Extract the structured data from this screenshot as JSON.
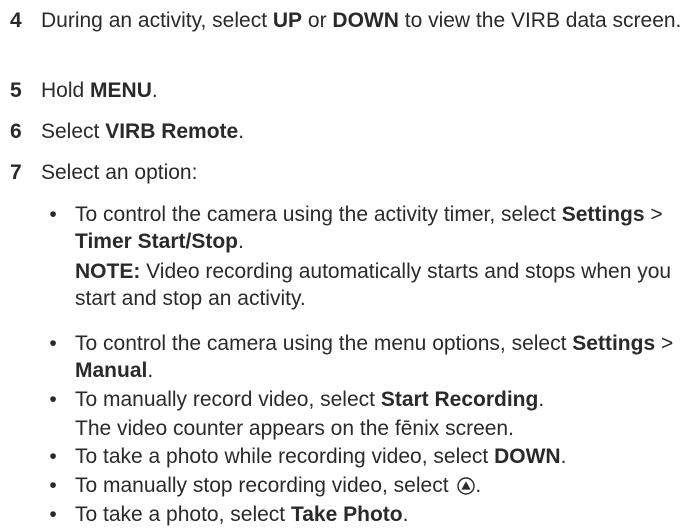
{
  "steps": [
    {
      "num": "4",
      "p1": "During an activity, select ",
      "b1": "UP",
      "p2": " or ",
      "b2": "DOWN",
      "p3": " to view the VIRB data screen."
    },
    {
      "num": "5",
      "p1": "Hold ",
      "b1": "MENU",
      "p2": "."
    },
    {
      "num": "6",
      "p1": "Select ",
      "b1": "VIRB Remote",
      "p2": "."
    },
    {
      "num": "7",
      "p1": "Select an option:"
    }
  ],
  "bullets": [
    {
      "p1": "To control the camera using the activity timer, select ",
      "b1": "Settings",
      "p2": " > ",
      "b2": "Timer Start/Stop",
      "p3": "."
    },
    {
      "p1": "To control the camera using the menu options, select ",
      "b1": "Settings",
      "p2": " > ",
      "b2": "Manual",
      "p3": "."
    },
    {
      "p1": "To manually record video, select ",
      "b1": "Start Recording",
      "p2": "."
    },
    {
      "p1": "To take a photo while recording video, select ",
      "b1": "DOWN",
      "p2": "."
    },
    {
      "p1": "To manually stop recording video, select ",
      "p2": "."
    },
    {
      "p1": "To take a photo, select ",
      "b1": "Take Photo",
      "p2": "."
    }
  ],
  "note": {
    "label": "NOTE:",
    "text": " Video recording automatically starts and stops when you start and stop an activity."
  },
  "counter_text": "The video counter appears on the fēnix screen.",
  "bullet_char": "•",
  "icons": {
    "stop": "stop-recording-icon"
  }
}
